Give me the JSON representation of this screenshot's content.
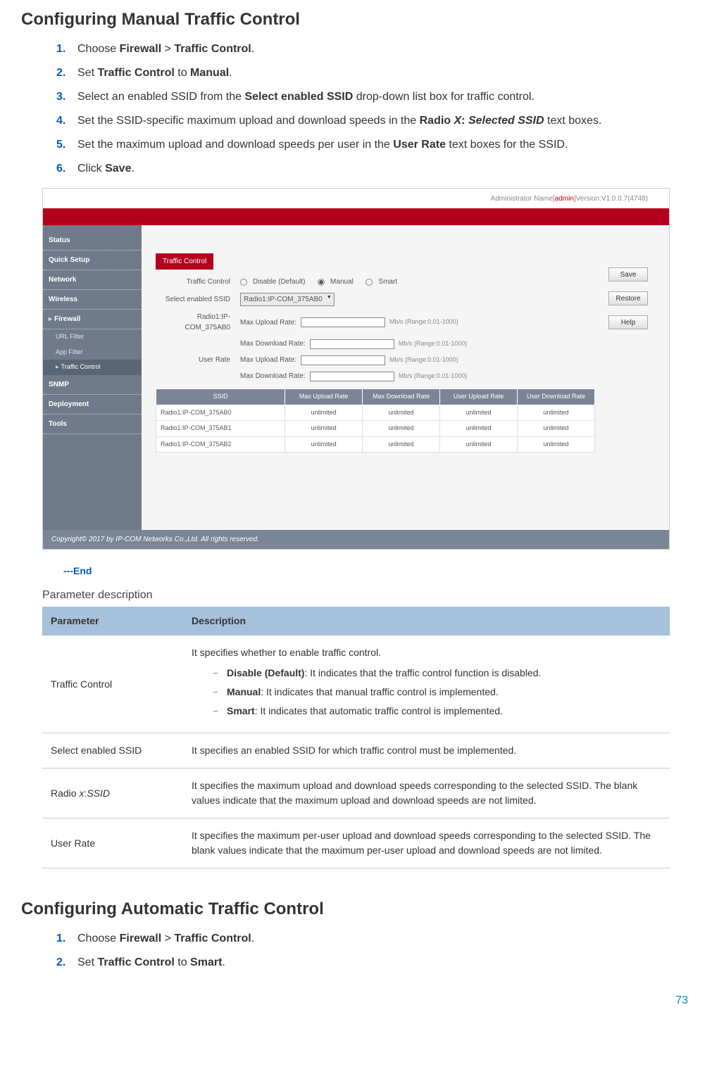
{
  "sections": {
    "manual": {
      "heading": "Configuring Manual Traffic Control",
      "steps": [
        {
          "pre": "Choose ",
          "b1": "Firewall",
          "mid": " > ",
          "b2": "Traffic Control",
          "post": "."
        },
        {
          "pre": "Set ",
          "b1": "Traffic Control",
          "mid": " to ",
          "b2": "Manual",
          "post": "."
        },
        {
          "pre": "Select an enabled SSID from the ",
          "b1": "Select enabled SSID",
          "post": " drop-down list box for traffic control."
        },
        {
          "pre": "Set the SSID-specific maximum upload and download speeds in the ",
          "b1": "Radio ",
          "it1": "X",
          "b2": ": ",
          "bit2": "Selected SSID",
          "post2": " text boxes."
        },
        {
          "pre": "Set the maximum upload and download speeds per user in the ",
          "b1": "User Rate",
          "post": " text boxes for the SSID."
        },
        {
          "pre": "Click ",
          "b1": "Save",
          "post": "."
        }
      ]
    },
    "auto": {
      "heading": "Configuring Automatic Traffic Control",
      "steps": [
        {
          "pre": "Choose ",
          "b1": "Firewall",
          "mid": " > ",
          "b2": "Traffic Control",
          "post": "."
        },
        {
          "pre": "Set ",
          "b1": "Traffic Control",
          "mid": " to ",
          "b2": "Smart",
          "post": "."
        }
      ]
    }
  },
  "end_marker": "---End",
  "param_title": "Parameter description",
  "param_table": {
    "headers": [
      "Parameter",
      "Description"
    ],
    "rows": [
      {
        "param": "Traffic Control",
        "desc_intro": "It specifies whether to enable traffic control.",
        "options": [
          {
            "name": "Disable (Default)",
            "text": ": It indicates that the traffic control function is disabled."
          },
          {
            "name": "Manual",
            "text": ": It indicates that manual traffic control is implemented."
          },
          {
            "name": "Smart",
            "text": ": It indicates that automatic traffic control is implemented."
          }
        ]
      },
      {
        "param": "Select enabled SSID",
        "desc": "It specifies an enabled SSID for which traffic control must be implemented."
      },
      {
        "param_html": "Radio <i>x</i>:<i>SSID</i>",
        "param_plain": "Radio x:SSID",
        "desc": "It specifies the maximum upload and download speeds corresponding to the selected SSID. The blank values indicate that the maximum upload and download speeds are not limited."
      },
      {
        "param": "User Rate",
        "desc": "It specifies the maximum per-user upload and download speeds corresponding to the selected SSID. The blank values indicate that the maximum per-user upload and download speeds are not limited."
      }
    ]
  },
  "admin_ui": {
    "top_left": "Administrator Name[",
    "top_name": "admin",
    "top_right": "]Version:V1.0.0.7(4748)",
    "sidebar": [
      {
        "type": "item",
        "label": "Status"
      },
      {
        "type": "item",
        "label": "Quick Setup"
      },
      {
        "type": "item",
        "label": "Network"
      },
      {
        "type": "item",
        "label": "Wireless"
      },
      {
        "type": "item",
        "label": "Firewall",
        "expanded": true
      },
      {
        "type": "sub",
        "label": "URL Filter"
      },
      {
        "type": "sub",
        "label": "App Filter"
      },
      {
        "type": "sub",
        "label": "Traffic Control",
        "active": true
      },
      {
        "type": "item",
        "label": "SNMP"
      },
      {
        "type": "item",
        "label": "Deployment"
      },
      {
        "type": "item",
        "label": "Tools"
      }
    ],
    "tab": "Traffic Control",
    "buttons": [
      "Save",
      "Restore",
      "Help"
    ],
    "form": {
      "traffic_control_label": "Traffic Control",
      "tc_options": [
        "Disable (Default)",
        "Manual",
        "Smart"
      ],
      "tc_selected": "Manual",
      "select_ssid_label": "Select enabled SSID",
      "select_ssid_value": "Radio1:IP-COM_375AB0",
      "radio_label": "Radio1:IP-COM_375AB0",
      "max_upload_label": "Max Upload Rate:",
      "max_download_label": "Max Download Rate:",
      "rate_unit": "Mb/s (Range:0.01-1000)",
      "user_rate_label": "User Rate"
    },
    "table": {
      "headers": [
        "SSID",
        "Max Upload Rate",
        "Max Download Rate",
        "User Upload Rate",
        "User Download Rate"
      ],
      "rows": [
        [
          "Radio1:IP-COM_375AB0",
          "unlimited",
          "unlimited",
          "unlimited",
          "unlimited"
        ],
        [
          "Radio1:IP-COM_375AB1",
          "unlimited",
          "unlimited",
          "unlimited",
          "unlimited"
        ],
        [
          "Radio1:IP-COM_375AB2",
          "unlimited",
          "unlimited",
          "unlimited",
          "unlimited"
        ]
      ]
    },
    "copyright": "Copyright© 2017 by IP-COM Networks Co.,Ltd. All rights reserved."
  },
  "page_number": "73"
}
